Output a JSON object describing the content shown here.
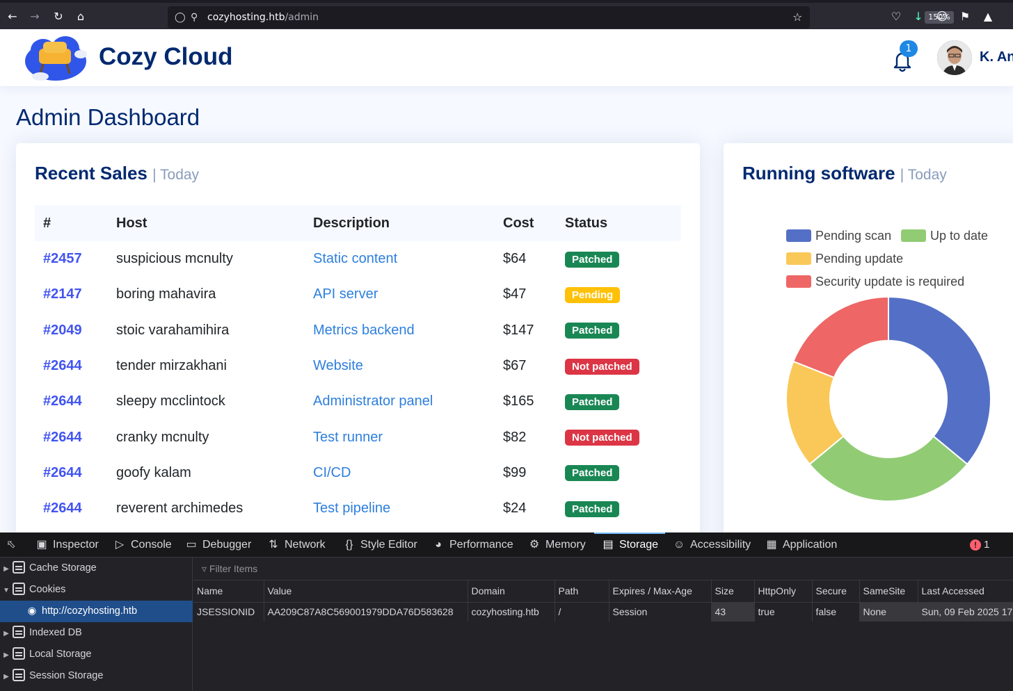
{
  "browser": {
    "url_host": "cozyhosting.htb",
    "url_path": "/admin",
    "zoom": "150%"
  },
  "header": {
    "brand": "Cozy Cloud",
    "notification_count": "1",
    "user_name": "K. An"
  },
  "page_title": "Admin Dashboard",
  "sales": {
    "title": "Recent Sales",
    "subtitle": "| Today",
    "columns": [
      "#",
      "Host",
      "Description",
      "Cost",
      "Status"
    ],
    "rows": [
      {
        "id": "#2457",
        "host": "suspicious mcnulty",
        "description": "Static content",
        "cost": "$64",
        "status": "Patched"
      },
      {
        "id": "#2147",
        "host": "boring mahavira",
        "description": "API server",
        "cost": "$47",
        "status": "Pending"
      },
      {
        "id": "#2049",
        "host": "stoic varahamihira",
        "description": "Metrics backend",
        "cost": "$147",
        "status": "Patched"
      },
      {
        "id": "#2644",
        "host": "tender mirzakhani",
        "description": "Website",
        "cost": "$67",
        "status": "Not patched"
      },
      {
        "id": "#2644",
        "host": "sleepy mcclintock",
        "description": "Administrator panel",
        "cost": "$165",
        "status": "Patched"
      },
      {
        "id": "#2644",
        "host": "cranky mcnulty",
        "description": "Test runner",
        "cost": "$82",
        "status": "Not patched"
      },
      {
        "id": "#2644",
        "host": "goofy kalam",
        "description": "CI/CD",
        "cost": "$99",
        "status": "Patched"
      },
      {
        "id": "#2644",
        "host": "reverent archimedes",
        "description": "Test pipeline",
        "cost": "$24",
        "status": "Patched"
      }
    ],
    "status_colors": {
      "Patched": "#198754",
      "Pending": "#ffc107",
      "Not patched": "#dc3545"
    }
  },
  "software": {
    "title": "Running software",
    "subtitle": "| Today"
  },
  "chart_data": {
    "type": "pie",
    "donut": true,
    "title": "",
    "legend_position": "top",
    "series": [
      {
        "name": "Pending scan",
        "value": 36,
        "color": "#5470c6"
      },
      {
        "name": "Up to date",
        "value": 28,
        "color": "#91cc75"
      },
      {
        "name": "Pending update",
        "value": 17,
        "color": "#fac858"
      },
      {
        "name": "Security update is required",
        "value": 19,
        "color": "#ee6666"
      }
    ]
  },
  "devtools": {
    "tabs": [
      {
        "label": "Inspector",
        "icon": "inspector-icon"
      },
      {
        "label": "Console",
        "icon": "console-icon"
      },
      {
        "label": "Debugger",
        "icon": "debugger-icon"
      },
      {
        "label": "Network",
        "icon": "network-icon"
      },
      {
        "label": "Style Editor",
        "icon": "style-editor-icon"
      },
      {
        "label": "Performance",
        "icon": "performance-icon"
      },
      {
        "label": "Memory",
        "icon": "memory-icon"
      },
      {
        "label": "Storage",
        "icon": "storage-icon"
      },
      {
        "label": "Accessibility",
        "icon": "accessibility-icon"
      },
      {
        "label": "Application",
        "icon": "application-icon"
      }
    ],
    "active_tab": "Storage",
    "error_count": "1",
    "tree": [
      "Cache Storage",
      "Cookies",
      "http://cozyhosting.htb",
      "Indexed DB",
      "Local Storage",
      "Session Storage"
    ],
    "filter_placeholder": "Filter Items",
    "cookie_columns": [
      "Name",
      "Value",
      "Domain",
      "Path",
      "Expires / Max-Age",
      "Size",
      "HttpOnly",
      "Secure",
      "SameSite",
      "Last Accessed"
    ],
    "cookie": {
      "name": "JSESSIONID",
      "value": "AA209C87A8C569001979DDA76D583628",
      "domain": "cozyhosting.htb",
      "path": "/",
      "expires": "Session",
      "size": "43",
      "httponly": "true",
      "secure": "false",
      "samesite": "None",
      "last_accessed": "Sun, 09 Feb 2025 17:"
    }
  }
}
